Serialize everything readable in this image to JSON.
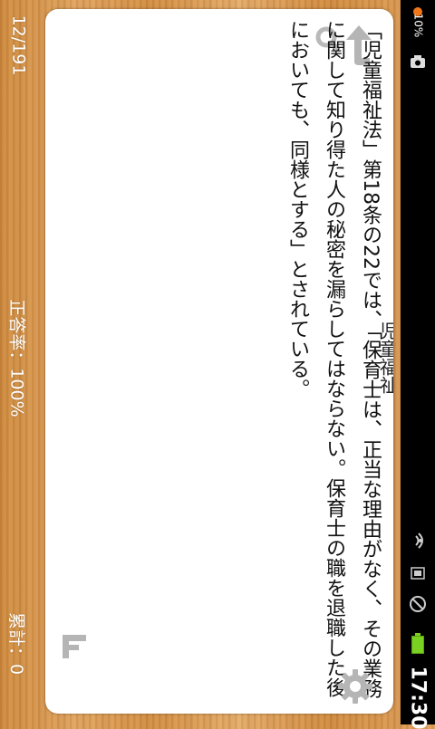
{
  "left_panel": {
    "counter": "12/191",
    "correct_rate": "正答率：100%",
    "total": "累計：0"
  },
  "card": {
    "title": "児童福祉",
    "question": "「児童福祉法」第18条の22では、「保育士は、正当な理由がなく、その業務に関して知り得た人の秘密を漏らしてはならない。保育士の職を退職した後においても、同様とする」とされている。"
  },
  "status_bar": {
    "battery_percent": "10%",
    "time": "17:30",
    "battery_color": "#7bd122",
    "alert_color": "#f0761a"
  },
  "icons": {
    "search": "search-icon",
    "back": "back-arrow-icon",
    "flag": "flag-f-icon",
    "settings": "gear-icon"
  }
}
